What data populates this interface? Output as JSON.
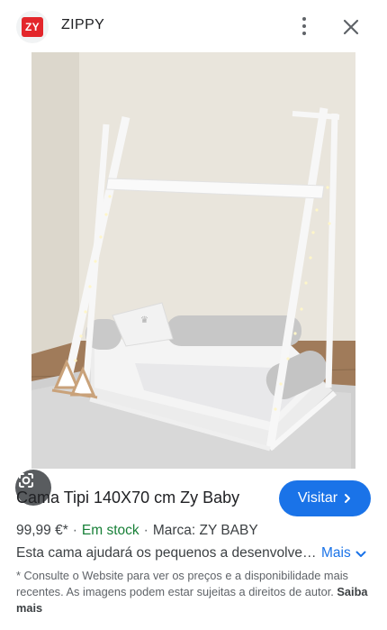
{
  "header": {
    "logo_text": "ZY",
    "site_name": "ZIPPY",
    "more_icon": "more-vert-icon",
    "close_icon": "close-icon"
  },
  "image": {
    "alt": "Cama Tipi 140X70 cm Zy Baby"
  },
  "product": {
    "title": "Cama Tipi 140X70 cm Zy Baby",
    "visit_label": "Visitar",
    "price": "99,99 €*",
    "stock": "Em stock",
    "brand": "Marca: ZY BABY",
    "description": "Esta cama ajudará os pequenos a desenvolver a sua autonomia",
    "more_label": "Mais",
    "disclaimer": "* Consulte o Website para ver os preços e a disponibilidade mais recentes. As imagens podem estar sujeitas a direitos de autor.",
    "learn_more": "Saiba mais"
  },
  "colors": {
    "accent": "#1a73e8",
    "stock": "#188038",
    "brand": "#e3262b"
  }
}
